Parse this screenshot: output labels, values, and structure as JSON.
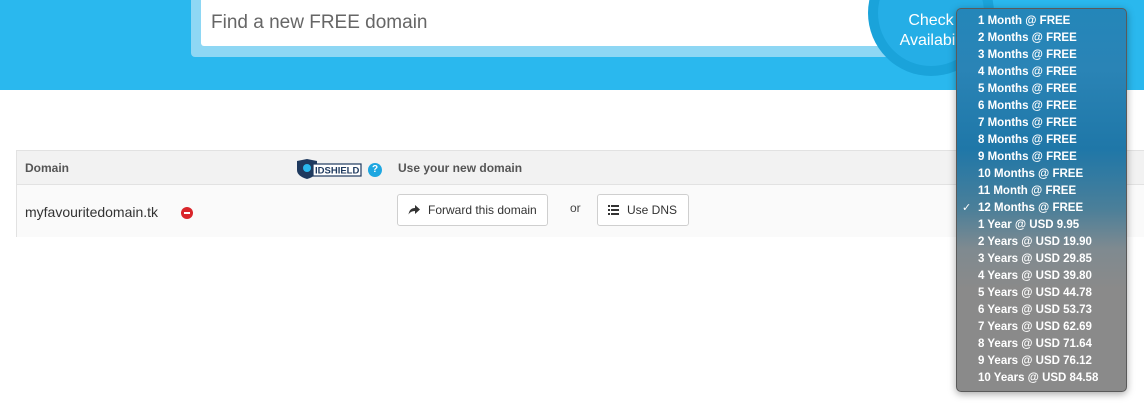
{
  "search": {
    "placeholder": "Find a new FREE domain",
    "button_line1": "Check",
    "button_line2": "Availabili"
  },
  "table": {
    "col_domain": "Domain",
    "col_use": "Use your new domain",
    "idshield_label": "IDSHIELD",
    "help_icon": "question-circle",
    "row": {
      "domain": "myfavouritedomain.tk",
      "forward_label": "Forward this domain",
      "or_label": "or",
      "dns_label": "Use DNS"
    }
  },
  "period_dropdown": {
    "selected": "12 Months @ FREE",
    "options": [
      "1 Month @ FREE",
      "2 Months @ FREE",
      "3 Months @ FREE",
      "4 Months @ FREE",
      "5 Months @ FREE",
      "6 Months @ FREE",
      "7 Months @ FREE",
      "8 Months @ FREE",
      "9 Months @ FREE",
      "10 Months @ FREE",
      "11 Month @ FREE",
      "12 Months @ FREE",
      "1 Year @ USD 9.95",
      "2 Years @ USD 19.90",
      "3 Years @ USD 29.85",
      "4 Years @ USD 39.80",
      "5 Years @ USD 44.78",
      "6 Years @ USD 53.73",
      "7 Years @ USD 62.69",
      "8 Years @ USD 71.64",
      "9 Years @ USD 76.12",
      "10 Years @ USD 84.58"
    ],
    "check_glyph": "✓"
  },
  "colors": {
    "hero_blue": "#2ab8ee",
    "remove_red": "#d9252a",
    "help_blue": "#1ea7e1"
  }
}
